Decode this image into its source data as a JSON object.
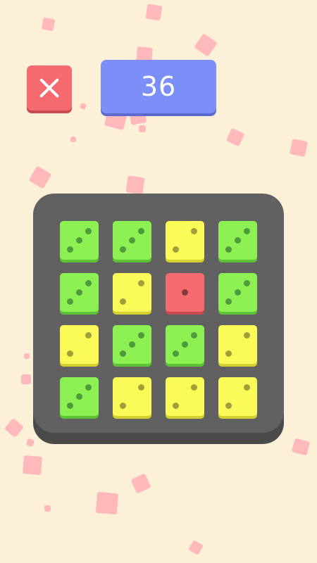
{
  "score": "36",
  "close_button": {
    "icon": "close-icon"
  },
  "colors": {
    "background": "#fdf0d8",
    "close_button": "#f46a6f",
    "score_box": "#7c8ff8",
    "board": "#616161",
    "green_die": "#8cf052",
    "yellow_die": "#fafa58",
    "red_die": "#f46a6f",
    "confetti": "#ffb3b8"
  },
  "board": {
    "rows": [
      [
        {
          "color": "green",
          "value": 3
        },
        {
          "color": "green",
          "value": 3
        },
        {
          "color": "yellow",
          "value": 2
        },
        {
          "color": "green",
          "value": 3
        }
      ],
      [
        {
          "color": "green",
          "value": 3
        },
        {
          "color": "yellow",
          "value": 2
        },
        {
          "color": "red",
          "value": 1
        },
        {
          "color": "green",
          "value": 3
        }
      ],
      [
        {
          "color": "yellow",
          "value": 2
        },
        {
          "color": "green",
          "value": 3
        },
        {
          "color": "green",
          "value": 3
        },
        {
          "color": "yellow",
          "value": 2
        }
      ],
      [
        {
          "color": "green",
          "value": 3
        },
        {
          "color": "yellow",
          "value": 2
        },
        {
          "color": "yellow",
          "value": 2
        },
        {
          "color": "yellow",
          "value": 2
        }
      ]
    ]
  }
}
